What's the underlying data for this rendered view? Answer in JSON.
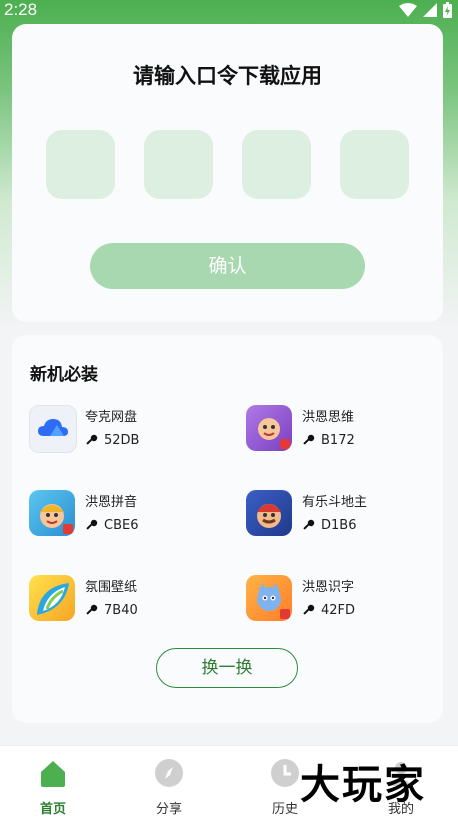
{
  "status_bar": {
    "time": "2:28"
  },
  "code_card": {
    "title": "请输入口令下载应用",
    "confirm_label": "确认"
  },
  "apps_card": {
    "title": "新机必装",
    "apps": [
      {
        "name": "夸克网盘",
        "code": "52DB",
        "icon": "cloud-icon",
        "color": "#2f6cf6"
      },
      {
        "name": "洪恩思维",
        "code": "B172",
        "icon": "cartoon-icon",
        "color": "#8a4fcf"
      },
      {
        "name": "洪恩拼音",
        "code": "CBE6",
        "icon": "cartoon-icon",
        "color": "#2aa0d8"
      },
      {
        "name": "有乐斗地主",
        "code": "D1B6",
        "icon": "cartoon-icon",
        "color": "#2f4fa8"
      },
      {
        "name": "氛围壁纸",
        "code": "7B40",
        "icon": "wallpaper-icon",
        "color": "#f5c42c"
      },
      {
        "name": "洪恩识字",
        "code": "42FD",
        "icon": "cartoon-icon",
        "color": "#ff9a3c"
      }
    ],
    "swap_label": "换一换"
  },
  "bottom_nav": {
    "items": [
      {
        "label": "首页",
        "icon": "home-icon",
        "active": true
      },
      {
        "label": "分享",
        "icon": "compass-icon",
        "active": false
      },
      {
        "label": "历史",
        "icon": "clock-icon",
        "active": false
      },
      {
        "label": "我的",
        "icon": "user-icon",
        "active": false
      }
    ]
  },
  "watermark": "大玩家",
  "colors": {
    "accent": "#2e7d32",
    "confirm_bg": "#a8d8b0",
    "code_box": "#dcefe0"
  }
}
